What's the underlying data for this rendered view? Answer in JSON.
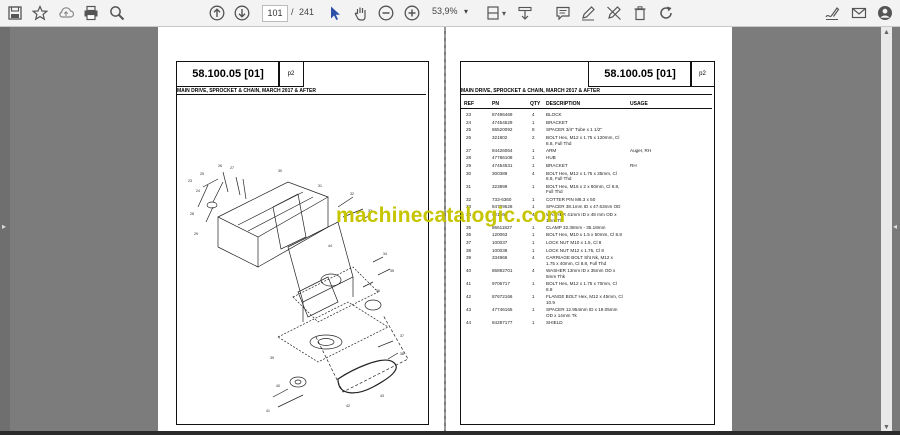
{
  "toolbar": {
    "current_page": "101",
    "page_separator": "/",
    "page_count": "241",
    "zoom": "53,9%"
  },
  "left_page": {
    "title": "58.100.05 [01]",
    "page_no": "p2",
    "subheading": "MAIN DRIVE, SPROCKET & CHAIN, MARCH 2017 & AFTER"
  },
  "right_page": {
    "title": "58.100.05 [01]",
    "page_no": "p2",
    "subheading": "MAIN DRIVE, SPROCKET & CHAIN, MARCH 2017 & AFTER",
    "headers": {
      "ref": "REF",
      "pn": "PN",
      "qty": "QTY",
      "desc": "DESCRIPTION",
      "usage": "USAGE"
    },
    "rows": [
      {
        "ref": "23",
        "pn": "87496469",
        "qty": "4",
        "desc": "BLOCK",
        "desc2": "",
        "usage": ""
      },
      {
        "ref": "24",
        "pn": "47454529",
        "qty": "1",
        "desc": "BRACKET",
        "desc2": "",
        "usage": ""
      },
      {
        "ref": "25",
        "pn": "86520092",
        "qty": "8",
        "desc": "SPACER 3/4\" Tube x 1 1/2\"",
        "desc2": "",
        "usage": ""
      },
      {
        "ref": "26",
        "pn": "321802",
        "qty": "2",
        "desc": "BOLT Hex, M12 x 1.75 x 120mm, Cl",
        "desc2": "8.8, Full Thd",
        "usage": ""
      },
      {
        "ref": "27",
        "pn": "84426064",
        "qty": "1",
        "desc": "ARM",
        "desc2": "",
        "usage": "Auger, RH"
      },
      {
        "ref": "28",
        "pn": "47786108",
        "qty": "1",
        "desc": "HUB",
        "desc2": "",
        "usage": ""
      },
      {
        "ref": "29",
        "pn": "47454531",
        "qty": "1",
        "desc": "BRACKET",
        "desc2": "",
        "usage": "RH"
      },
      {
        "ref": "30",
        "pn": "300389",
        "qty": "4",
        "desc": "BOLT Hex, M12 x 1.75 x 35mm, Cl",
        "desc2": "8.8, Full Thd",
        "usage": ""
      },
      {
        "ref": "31",
        "pn": "323899",
        "qty": "1",
        "desc": "BOLT Hex, M16 x 2 x 60mm, Cl 8.8,",
        "desc2": "Full Thd",
        "usage": ""
      },
      {
        "ref": "32",
        "pn": "733-6360",
        "qty": "1",
        "desc": "COTTER PIN M6.3 x 50",
        "desc2": "",
        "usage": ""
      },
      {
        "ref": "33",
        "pn": "84709528",
        "qty": "1",
        "desc": "SPACER 38.1mm ID x 47.63mm OD",
        "desc2": "",
        "usage": ""
      },
      {
        "ref": "34",
        "pn": "42156",
        "qty": "4",
        "desc": "WASHER 41mm ID x 48 mm OD x",
        "desc2": "1mm Tk",
        "usage": ""
      },
      {
        "ref": "35",
        "pn": "86611827",
        "qty": "1",
        "desc": "CLAMP 32.38mm - 35.18mm",
        "desc2": "",
        "usage": ""
      },
      {
        "ref": "36",
        "pn": "120063",
        "qty": "1",
        "desc": "BOLT Hex, M10 x 1.5 x 50mm, Cl 8.8",
        "desc2": "",
        "usage": ""
      },
      {
        "ref": "37",
        "pn": "100037",
        "qty": "1",
        "desc": "LOCK NUT M10 x 1.5, Cl 8",
        "desc2": "",
        "usage": ""
      },
      {
        "ref": "38",
        "pn": "100038",
        "qty": "1",
        "desc": "LOCK NUT M12 x 1.75, Cl 8",
        "desc2": "",
        "usage": ""
      },
      {
        "ref": "39",
        "pn": "334966",
        "qty": "4",
        "desc": "CARRIAGE BOLT Sht Nk, M12 x",
        "desc2": "1.75 x 40mm, Cl 8.8, Full Thd",
        "usage": ""
      },
      {
        "ref": "40",
        "pn": "86892701",
        "qty": "4",
        "desc": "WASHER 13mm ID x 35mm OD x",
        "desc2": "5mm Thk",
        "usage": ""
      },
      {
        "ref": "41",
        "pn": "9706717",
        "qty": "1",
        "desc": "BOLT Hex, M12 x 1.75 x 70mm, Cl",
        "desc2": "8.8",
        "usage": ""
      },
      {
        "ref": "42",
        "pn": "87672166",
        "qty": "1",
        "desc": "FLANGE BOLT Hex, M12 x 45mm, Cl",
        "desc2": "10.9",
        "usage": ""
      },
      {
        "ref": "43",
        "pn": "47746165",
        "qty": "1",
        "desc": "SPACER 12.954mm ID x 19.05mm",
        "desc2": "OD x 14mm Tk",
        "usage": ""
      },
      {
        "ref": "44",
        "pn": "84287177",
        "qty": "1",
        "desc": "SHIELD",
        "desc2": "",
        "usage": ""
      }
    ]
  },
  "watermark": "machinecatalogic.com",
  "icons": [
    "save-icon",
    "bookmark-star-icon",
    "upload-cloud-icon",
    "print-icon",
    "zoom-search-icon",
    "page-up-icon",
    "page-down-icon",
    "cursor-select-icon",
    "hand-pan-icon",
    "zoom-out-icon",
    "zoom-in-icon",
    "fit-page-icon",
    "read-mode-icon",
    "comment-icon",
    "pen-icon",
    "eraser-icon",
    "delete-icon",
    "rotate-icon",
    "sign-icon",
    "mail-icon",
    "account-icon"
  ]
}
